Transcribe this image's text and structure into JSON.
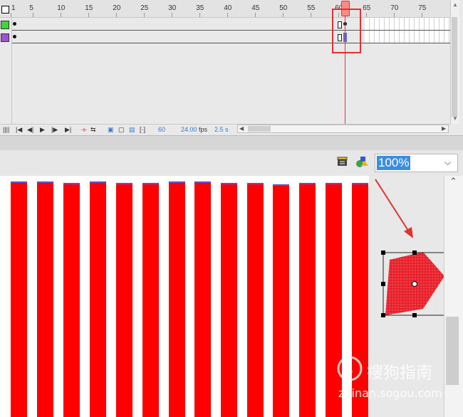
{
  "timeline": {
    "frame_numbers": [
      "1",
      "5",
      "10",
      "15",
      "20",
      "25",
      "30",
      "35",
      "40",
      "45",
      "50",
      "55",
      "60",
      "65",
      "70",
      "75"
    ],
    "current_frame": 61,
    "layers": [
      {
        "color": "#3dd43d"
      },
      {
        "color": "#a050d0"
      }
    ],
    "footer": {
      "frame": "60",
      "fps_value": "24.00",
      "fps_unit": "fps",
      "time": "2.5 s"
    }
  },
  "stage": {
    "zoom": "100%",
    "bar_color": "#ff0000",
    "shape_color": "#e8232e"
  },
  "watermark": {
    "brand": "搜狗指南",
    "url": "zhinan.sogou.com"
  }
}
